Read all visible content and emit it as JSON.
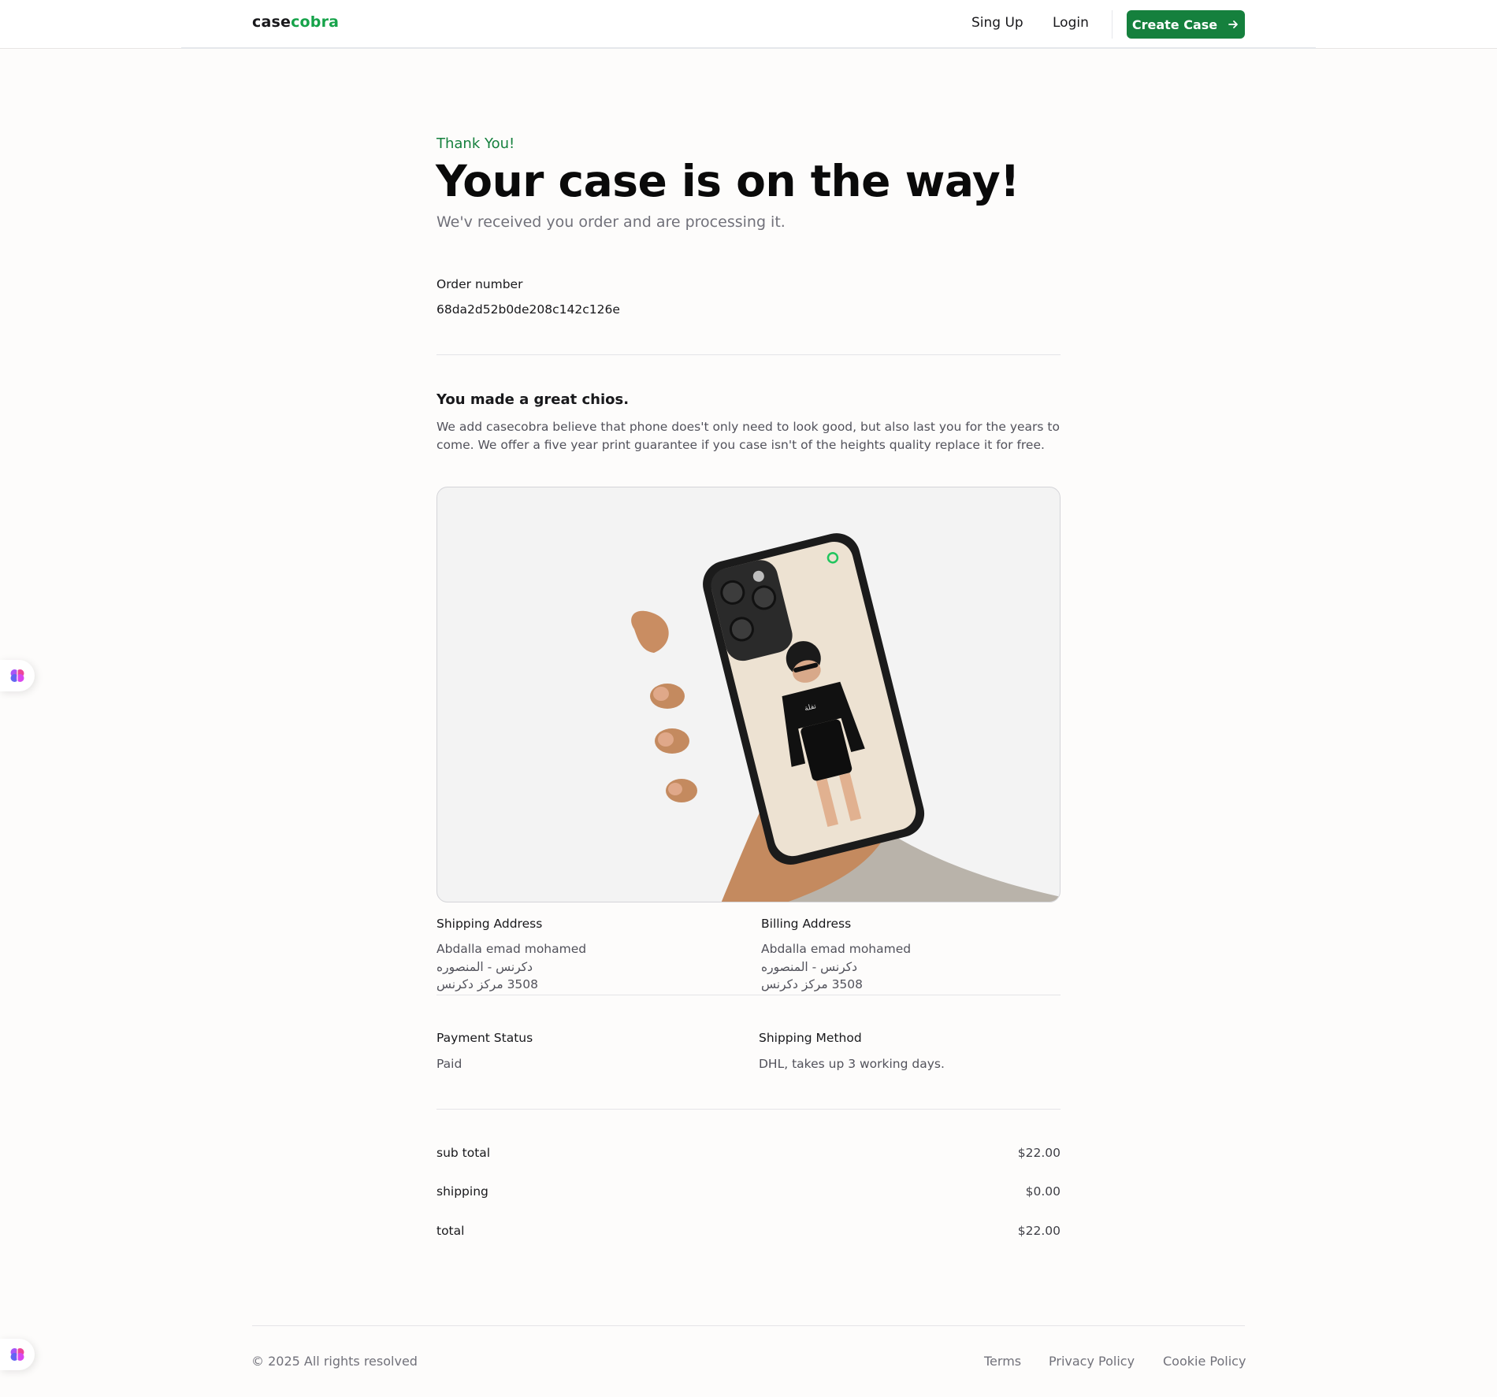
{
  "navbar": {
    "logo_part1": "case",
    "logo_part2": "cobra",
    "signup_label": "Sing Up",
    "login_label": "Login",
    "create_case_label": "Create Case"
  },
  "main": {
    "thank_you": "Thank You!",
    "headline": "Your case is on the way!",
    "subheadline": "We'v received you order and are processing it.",
    "order_number_label": "Order number",
    "order_number_value": "68da2d52b0de208c142c126e",
    "choice_title": "You made a great chios.",
    "choice_text": "We add casecobra believe that phone does't only need to look good, but also last you for the years to come. We offer a five year print guarantee if you case isn't of the heights quality replace it for free."
  },
  "shipping_address": {
    "label": "Shipping Address",
    "name": "Abdalla emad mohamed",
    "line1": "دكرنس - المنصوره",
    "line2": "3508 مركز دكرنس"
  },
  "billing_address": {
    "label": "Billing Address",
    "name": "Abdalla emad mohamed",
    "line1": "دكرنس - المنصوره",
    "line2": "3508 مركز دكرنس"
  },
  "payment": {
    "status_label": "Payment Status",
    "status_value": "Paid",
    "method_label": "Shipping Method",
    "method_value": "DHL, takes up 3 working days."
  },
  "summary": {
    "subtotal_label": "sub total",
    "subtotal_value": "$22.00",
    "shipping_label": "shipping",
    "shipping_value": "$0.00",
    "total_label": "total",
    "total_value": "$22.00"
  },
  "footer": {
    "copyright": "© 2025 All rights resolved",
    "terms": "Terms",
    "privacy": "Privacy Policy",
    "cookie": "Cookie Policy"
  },
  "colors": {
    "brand_green": "#15803d",
    "logo_green": "#16a34a",
    "preview_bg": "#f3f3f3"
  },
  "icons": {
    "create_case_arrow": "arrow-right-icon",
    "floating_widget": "brain-icon"
  }
}
